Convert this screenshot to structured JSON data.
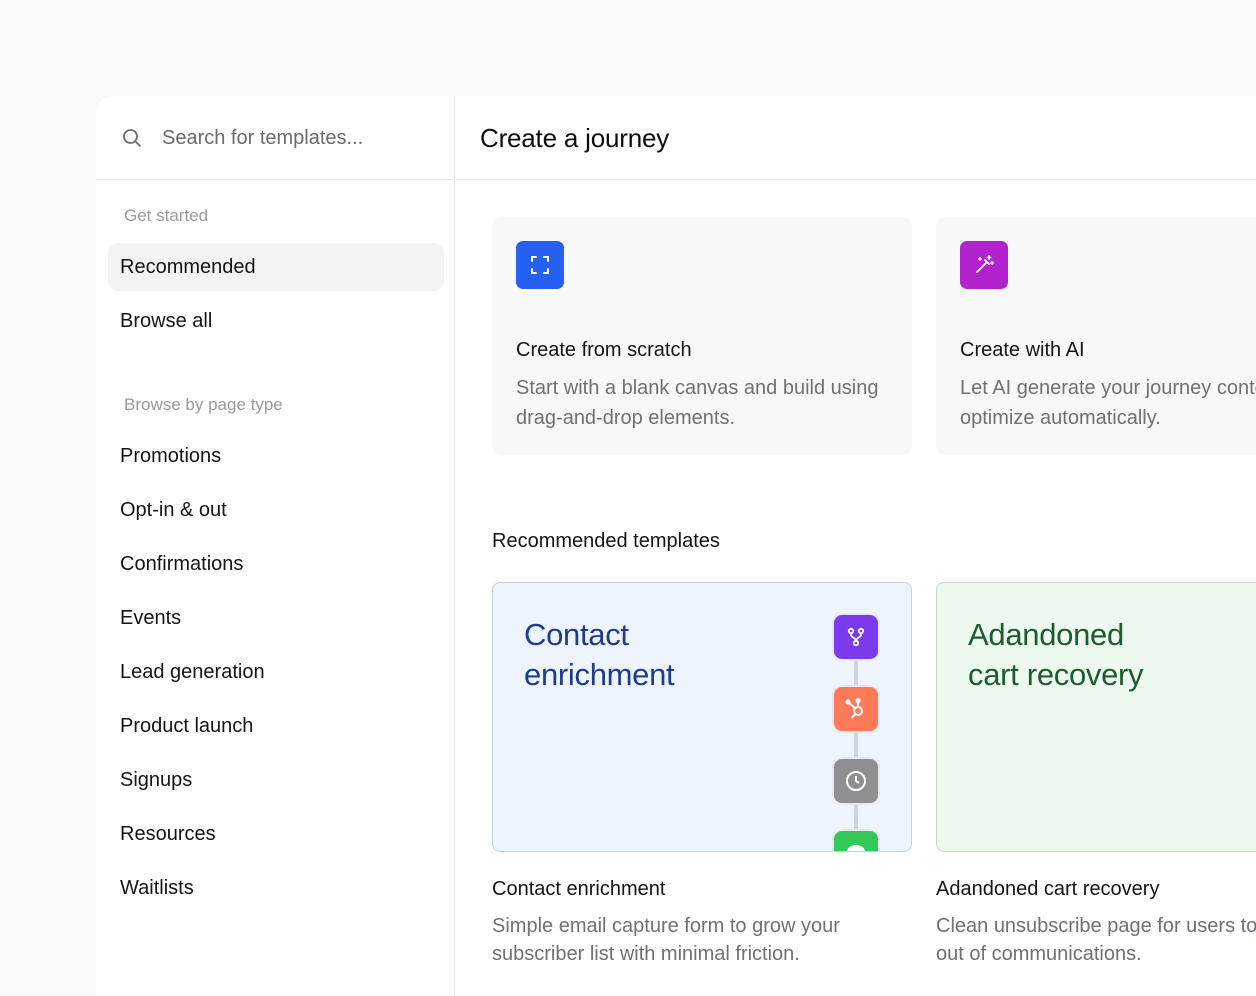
{
  "search": {
    "placeholder": "Search for templates..."
  },
  "sidebar": {
    "get_started_label": "Get started",
    "get_started_items": [
      {
        "label": "Recommended",
        "active": true
      },
      {
        "label": "Browse all",
        "active": false
      }
    ],
    "page_type_label": "Browse by page type",
    "page_type_items": [
      {
        "label": "Promotions"
      },
      {
        "label": "Opt-in & out"
      },
      {
        "label": "Confirmations"
      },
      {
        "label": "Events"
      },
      {
        "label": "Lead generation"
      },
      {
        "label": "Product launch"
      },
      {
        "label": "Signups"
      },
      {
        "label": "Resources"
      },
      {
        "label": "Waitlists"
      }
    ]
  },
  "main": {
    "title": "Create a journey",
    "create_cards": [
      {
        "title": "Create from scratch",
        "description": "Start with a blank canvas and build using drag-and-drop elements.",
        "icon": "scan-frame-icon",
        "icon_color": "#2660f0"
      },
      {
        "title": "Create with AI",
        "description": "Let AI generate your journey content and optimize automatically.",
        "icon": "magic-wand-icon",
        "icon_color": "#b322cf"
      }
    ],
    "recommended_heading": "Recommended templates",
    "templates": [
      {
        "preview_text_line1": "Contact",
        "preview_text_line2": "enrichment",
        "title": "Contact enrichment",
        "description": "Simple email capture form to grow your subscriber list with minimal friction.",
        "preview_bg": "#eef4fd",
        "preview_border": "#c9cfd8",
        "text_color": "#1f3b8c"
      },
      {
        "preview_text_line1": "Adandoned",
        "preview_text_line2": "cart recovery",
        "title": "Adandoned cart recovery",
        "description": "Clean unsubscribe page for users to easily opt out of communications.",
        "preview_bg": "#edf9ef",
        "preview_border": "#c9d8cc",
        "text_color": "#1e5b2e"
      }
    ],
    "flow_nodes": [
      {
        "icon": "branch-icon",
        "color": "#7c3aed"
      },
      {
        "icon": "hubspot-icon",
        "color": "#ff7a59"
      },
      {
        "icon": "clock-icon",
        "color": "#8e8e93"
      },
      {
        "icon": "message-icon",
        "color": "#34c759"
      }
    ]
  }
}
